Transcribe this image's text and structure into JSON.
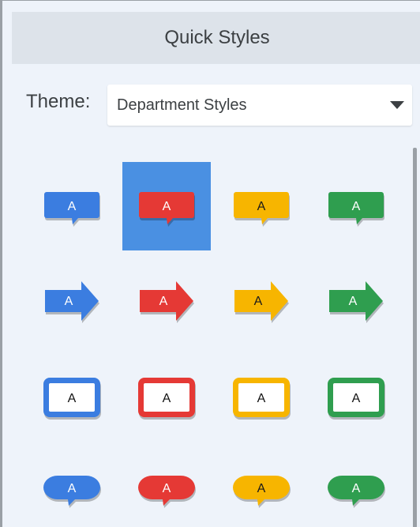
{
  "panel": {
    "title": "Quick Styles",
    "theme_label": "Theme:",
    "theme_value": "Department Styles"
  },
  "colors": {
    "blue": "#3b7de0",
    "red": "#e53935",
    "yellow": "#f7b500",
    "green": "#2f9e4f",
    "selected": "#4a90e2"
  },
  "styles": [
    {
      "shape": "callout",
      "color": "blue",
      "label": "A",
      "selected": false
    },
    {
      "shape": "callout",
      "color": "red",
      "label": "A",
      "selected": true
    },
    {
      "shape": "callout",
      "color": "yellow",
      "label": "A",
      "selected": false
    },
    {
      "shape": "callout",
      "color": "green",
      "label": "A",
      "selected": false
    },
    {
      "shape": "arrow",
      "color": "blue",
      "label": "A",
      "selected": false
    },
    {
      "shape": "arrow",
      "color": "red",
      "label": "A",
      "selected": false
    },
    {
      "shape": "arrow",
      "color": "yellow",
      "label": "A",
      "selected": false
    },
    {
      "shape": "arrow",
      "color": "green",
      "label": "A",
      "selected": false
    },
    {
      "shape": "box",
      "color": "blue",
      "label": "A",
      "selected": false
    },
    {
      "shape": "box",
      "color": "red",
      "label": "A",
      "selected": false
    },
    {
      "shape": "box",
      "color": "yellow",
      "label": "A",
      "selected": false
    },
    {
      "shape": "box",
      "color": "green",
      "label": "A",
      "selected": false
    },
    {
      "shape": "bubble",
      "color": "blue",
      "label": "A",
      "selected": false
    },
    {
      "shape": "bubble",
      "color": "red",
      "label": "A",
      "selected": false
    },
    {
      "shape": "bubble",
      "color": "yellow",
      "label": "A",
      "selected": false
    },
    {
      "shape": "bubble",
      "color": "green",
      "label": "A",
      "selected": false
    }
  ]
}
